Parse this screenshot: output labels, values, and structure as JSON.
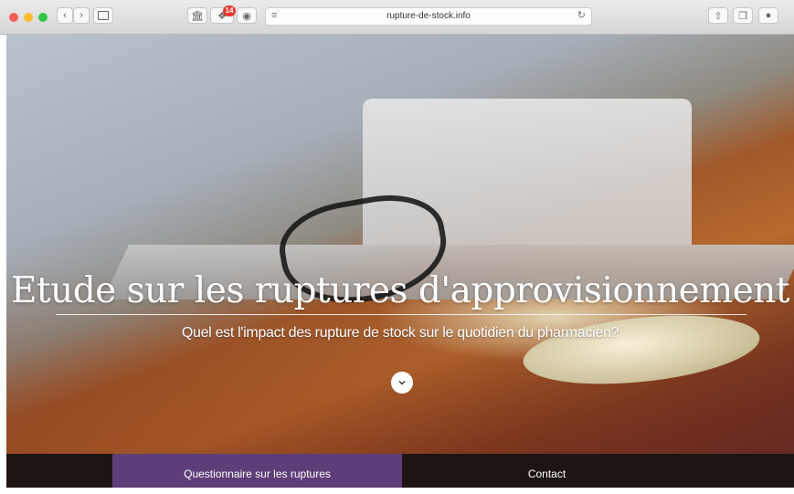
{
  "browser": {
    "url": "rupture-de-stock.info",
    "extension_badge_count": "14",
    "traffic_lights": {
      "close": "#fc5f57",
      "minimize": "#fdbc2e",
      "zoom": "#33c748"
    }
  },
  "hero": {
    "title": "Etude sur les ruptures d'approvisionnement",
    "subtitle": "Quel est l'impact des rupture de stock sur le quotidien du pharmacien?",
    "scroll_icon": "chevron-down-icon"
  },
  "nav": {
    "items": [
      {
        "label": "Questionnaire sur les ruptures",
        "active": true
      },
      {
        "label": "Contact",
        "active": false
      }
    ],
    "active_color": "#5e3e78"
  }
}
